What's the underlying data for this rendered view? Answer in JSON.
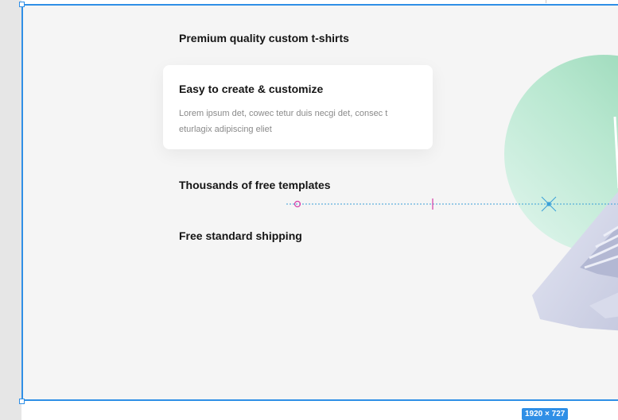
{
  "features": [
    {
      "title": "Premium quality custom t-shirts"
    },
    {
      "title": "Easy to create & customize",
      "body": "Lorem ipsum det, cowec tetur duis necgi det, consec t eturlagix adipiscing eliet"
    },
    {
      "title": "Thousands of free templates"
    },
    {
      "title": "Free standard shipping"
    }
  ],
  "canvas": {
    "size_label": "1920 × 727"
  },
  "colors": {
    "selection": "#2f8fe6",
    "guide": "#3aa0d8",
    "measure": "#d63ca7",
    "circle_light": "#d6f2ea",
    "circle_dark": "#8fd3b0",
    "laptop": "#c9cde3"
  },
  "icons": [
    "laptop-illustration",
    "mint-circle-decoration",
    "guide-anchor-icon",
    "guide-target-icon"
  ]
}
